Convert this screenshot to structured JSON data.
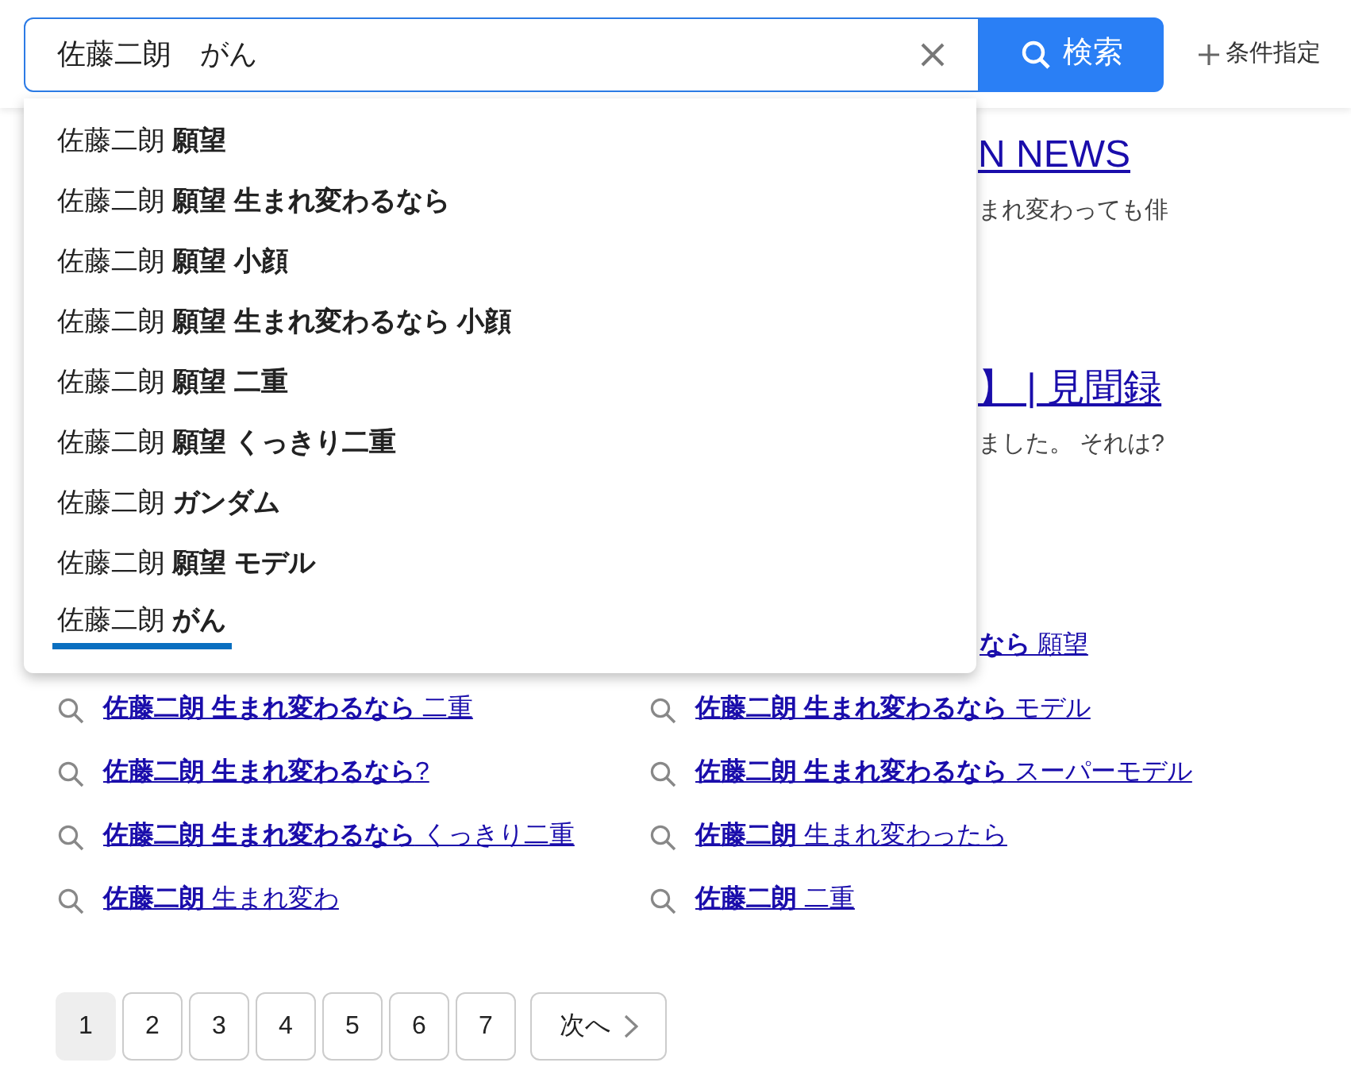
{
  "search": {
    "value": "佐藤二朗　がん",
    "button": "検索"
  },
  "advanced": "条件指定",
  "suggestions": [
    {
      "text": "佐藤二朗 **願望**",
      "selected": false
    },
    {
      "text": "佐藤二朗 **願望 生まれ変わるなら**",
      "selected": false
    },
    {
      "text": "佐藤二朗 **願望 小顔**",
      "selected": false
    },
    {
      "text": "佐藤二朗 **願望 生まれ変わるなら 小顔**",
      "selected": false
    },
    {
      "text": "佐藤二朗 **願望 二重**",
      "selected": false
    },
    {
      "text": "佐藤二朗 **願望 くっきり二重**",
      "selected": false
    },
    {
      "text": "佐藤二朗 **ガンダム**",
      "selected": false
    },
    {
      "text": "佐藤二朗 **願望 モデル**",
      "selected": false
    },
    {
      "text": "佐藤二朗 **がん**",
      "selected": true
    }
  ],
  "results": [
    {
      "title": "N NEWS",
      "snippet": "まれ変わっても俳"
    },
    {
      "title": "】 | 見聞録",
      "snippet": "ました。 それは?"
    }
  ],
  "related_partial": "**なら** 願望",
  "related": [
    "**佐藤二朗 生まれ変わるなら** 二重",
    "**佐藤二朗 生まれ変わるなら** モデル",
    "**佐藤二朗 生まれ変わるなら**?",
    "**佐藤二朗 生まれ変わるなら** スーパーモデル",
    "**佐藤二朗 生まれ変わるなら** くっきり二重",
    "**佐藤二朗** 生まれ変わったら",
    "**佐藤二朗** 生まれ変わ",
    "**佐藤二朗** 二重"
  ],
  "pagination": {
    "pages": [
      {
        "label": "1",
        "selected": true
      },
      {
        "label": "2",
        "selected": false
      },
      {
        "label": "3",
        "selected": false
      },
      {
        "label": "4",
        "selected": false
      },
      {
        "label": "5",
        "selected": false
      },
      {
        "label": "6",
        "selected": false
      },
      {
        "label": "7",
        "selected": false
      }
    ],
    "next": "次へ"
  }
}
